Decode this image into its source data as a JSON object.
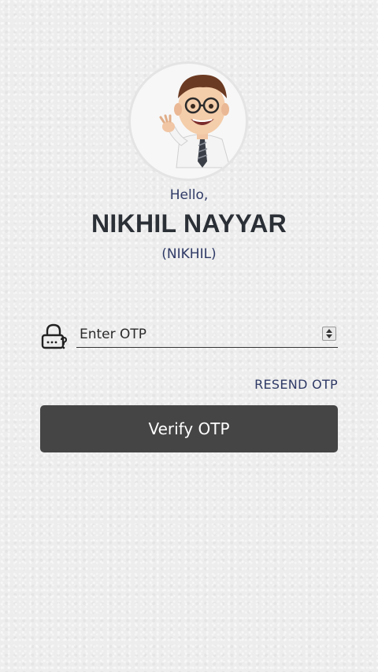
{
  "profile": {
    "avatar_icon": "cartoon-man-avatar-icon",
    "greeting": "Hello,",
    "full_name": "NIKHIL NAYYAR",
    "username": "(NIKHIL)"
  },
  "otp": {
    "lock_icon": "lock-question-icon",
    "placeholder": "Enter OTP",
    "value": "",
    "resend_label": "RESEND OTP",
    "verify_label": "Verify OTP"
  },
  "colors": {
    "primary_text": "#2f3a66",
    "button_bg": "#454545",
    "name_text": "#2b2f36"
  }
}
